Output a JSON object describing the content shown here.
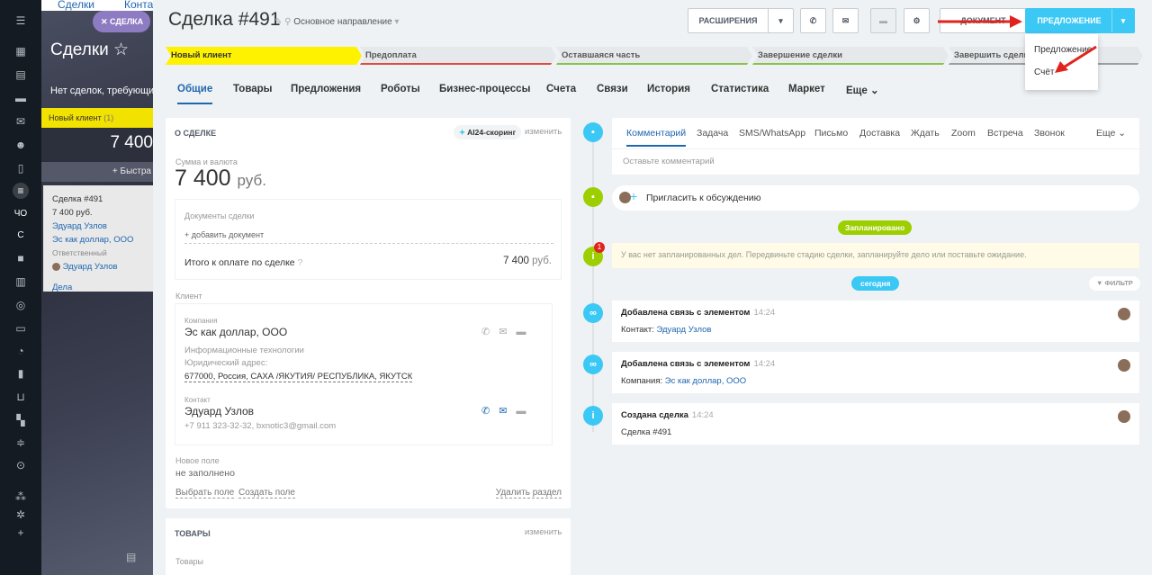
{
  "backdrop": {
    "tabs": [
      "Сделки",
      "Конта"
    ],
    "pill": "СДЕЛКА",
    "title": "Сделки",
    "subtitle": "Нет сделок, требующих",
    "column_title": "Новый клиент",
    "column_count": "(1)",
    "column_sum": "7 400",
    "quick_label": "+ Быстра",
    "card": {
      "title": "Сделка #491",
      "sum": "7 400 руб.",
      "company": "Эдуард Узлов",
      "company2": "Эс как доллар, ООО",
      "resp_label": "Ответственный",
      "resp": "Эдуард Узлов",
      "deals": "Дела"
    }
  },
  "leftbar": {
    "texts": [
      "ЧО",
      "С"
    ]
  },
  "header": {
    "title": "Сделка #491",
    "direction": "Основное направление",
    "btn_extensions": "РАСШИРЕНИЯ",
    "btn_document": "ДОКУМЕНТ",
    "btn_offer": "ПРЕДЛОЖЕНИЕ"
  },
  "dropdown": {
    "items": [
      "Предложение",
      "Счёт"
    ]
  },
  "stages": [
    {
      "label": "Новый клиент",
      "color": "#fff200"
    },
    {
      "label": "Предоплата",
      "color": "#e24c3f"
    },
    {
      "label": "Оставшаяся часть",
      "color": "#8bc34a"
    },
    {
      "label": "Завершение сделки",
      "color": "#8bc34a"
    },
    {
      "label": "Завершить сделку",
      "color": "#9e9e9e"
    }
  ],
  "tabs": [
    "Общие",
    "Товары",
    "Предложения",
    "Роботы",
    "Бизнес-процессы",
    "Счета",
    "Связи",
    "История",
    "Статистика",
    "Маркет",
    "Еще"
  ],
  "about": {
    "heading": "О СДЕЛКЕ",
    "scoring": "AI24-скоринг",
    "edit": "изменить",
    "sum_label": "Сумма и валюта",
    "sum": "7 400",
    "currency": "руб.",
    "docs_label": "Документы сделки",
    "add_doc": "+ добавить документ",
    "total_label": "Итого к оплате по сделке",
    "total": "7 400",
    "total_cur": "руб.",
    "client_label": "Клиент",
    "company_label": "Компания",
    "company": "Эс как доллар, ООО",
    "industry": "Информационные технологии",
    "address_label": "Юридический адрес:",
    "address": "677000, Россия, САХА /ЯКУТИЯ/ РЕСПУБЛИКА, ЯКУТСК",
    "contact_label": "Контакт",
    "contact": "Эдуард Узлов",
    "contact_info": "+7 911 323-32-32, bxnotic3@gmail.com",
    "newfield_label": "Новое поле",
    "newfield_value": "не заполнено",
    "select_field": "Выбрать поле",
    "create_field": "Создать поле",
    "delete_section": "Удалить раздел"
  },
  "products": {
    "heading": "ТОВАРЫ",
    "edit": "изменить",
    "label": "Товары"
  },
  "activity": {
    "tabs": [
      "Комментарий",
      "Задача",
      "SMS/WhatsApp",
      "Письмо",
      "Доставка",
      "Ждать",
      "Zoom",
      "Встреча",
      "Звонок",
      "Еще"
    ],
    "placeholder": "Оставьте комментарий",
    "invite": "Пригласить к обсуждению",
    "planned": "Запланировано",
    "planned_text": "У вас нет запланированных дел. Передвиньте стадию сделки, запланируйте дело или поставьте ожидание.",
    "badge": "1",
    "today": "сегодня",
    "filter": "ФИЛЬТР"
  },
  "timeline": [
    {
      "title": "Добавлена связь с элементом",
      "time": "14:24",
      "label": "Контакт:",
      "value": "Эдуард Узлов"
    },
    {
      "title": "Добавлена связь с элементом",
      "time": "14:24",
      "label": "Компания:",
      "value": "Эс как доллар, ООО"
    },
    {
      "title": "Создана сделка",
      "time": "14:24",
      "label": "",
      "value": "Сделка #491"
    }
  ],
  "colors": {
    "accent": "#3bc8f5",
    "green": "#9dcf00",
    "blue": "#2067b0",
    "yellow": "#fff200"
  }
}
